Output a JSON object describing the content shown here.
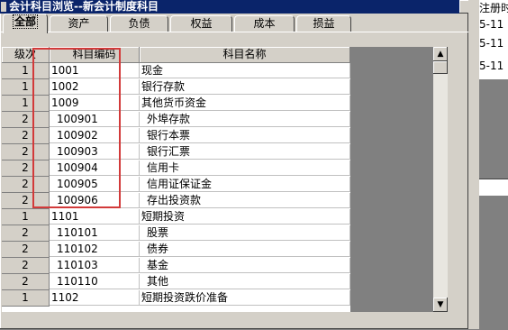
{
  "window": {
    "title": "会计科目浏览--新会计制度科目"
  },
  "tabs": [
    {
      "label": "全部",
      "active": true
    },
    {
      "label": "资产"
    },
    {
      "label": "负债"
    },
    {
      "label": "权益"
    },
    {
      "label": "成本"
    },
    {
      "label": "损益"
    }
  ],
  "grid": {
    "headers": {
      "level": "级次",
      "code": "科目编码",
      "name": "科目名称"
    },
    "rows": [
      {
        "level": "1",
        "code": "1001",
        "name": "现金"
      },
      {
        "level": "1",
        "code": "1002",
        "name": "银行存款"
      },
      {
        "level": "1",
        "code": "1009",
        "name": "其他货币资金"
      },
      {
        "level": "2",
        "code": "100901",
        "name": "外埠存款"
      },
      {
        "level": "2",
        "code": "100902",
        "name": "银行本票"
      },
      {
        "level": "2",
        "code": "100903",
        "name": "银行汇票"
      },
      {
        "level": "2",
        "code": "100904",
        "name": "信用卡"
      },
      {
        "level": "2",
        "code": "100905",
        "name": "信用证保证金"
      },
      {
        "level": "2",
        "code": "100906",
        "name": "存出投资款"
      },
      {
        "level": "1",
        "code": "1101",
        "name": "短期投资"
      },
      {
        "level": "2",
        "code": "110101",
        "name": "股票"
      },
      {
        "level": "2",
        "code": "110102",
        "name": "债券"
      },
      {
        "level": "2",
        "code": "110103",
        "name": "基金"
      },
      {
        "level": "2",
        "code": "110110",
        "name": "其他"
      },
      {
        "level": "1",
        "code": "1102",
        "name": "短期投资跌价准备"
      }
    ]
  },
  "background_window": {
    "header": "注册时",
    "lines": [
      "5-11",
      "5-11",
      "5-11"
    ]
  },
  "colors": {
    "highlight_box": "#d23a3a",
    "titlebar": "#0a246a"
  }
}
